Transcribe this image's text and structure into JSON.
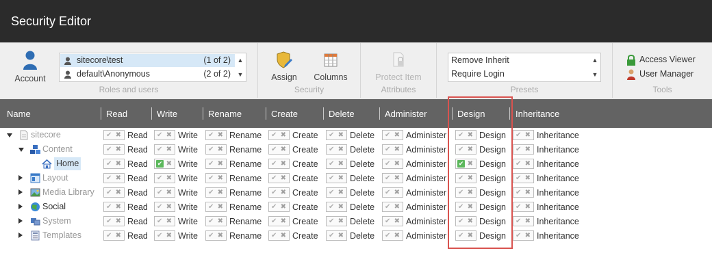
{
  "app": {
    "title": "Security Editor"
  },
  "ribbon": {
    "account_label": "Account",
    "users_list": [
      {
        "name": "sitecore\\test",
        "count": "(1 of 2)",
        "selected": true
      },
      {
        "name": "default\\Anonymous",
        "count": "(2 of 2)",
        "selected": false
      }
    ],
    "roles_group_label": "Roles and users",
    "assign_label": "Assign",
    "columns_label": "Columns",
    "security_group_label": "Security",
    "protect_item_label": "Protect Item",
    "attributes_group_label": "Attributes",
    "presets": [
      "Remove Inherit",
      "Require Login"
    ],
    "presets_group_label": "Presets",
    "access_viewer_label": "Access Viewer",
    "user_manager_label": "User Manager",
    "tools_group_label": "Tools"
  },
  "columns": [
    "Name",
    "Read",
    "Write",
    "Rename",
    "Create",
    "Delete",
    "Administer",
    "Design",
    "Inheritance"
  ],
  "permission_labels": [
    "Read",
    "Write",
    "Rename",
    "Create",
    "Delete",
    "Administer",
    "Design",
    "Inheritance"
  ],
  "tree": [
    {
      "name": "sitecore",
      "expander": "down",
      "icon": "page-icon",
      "style": "muted",
      "granted": []
    },
    {
      "name": "Content",
      "expander": "down",
      "icon": "cubes-icon",
      "style": "muted",
      "granted": []
    },
    {
      "name": "Home",
      "expander": "none",
      "icon": "home-icon",
      "style": "selected",
      "granted": [
        "Write",
        "Design"
      ]
    },
    {
      "name": "Layout",
      "expander": "right",
      "icon": "layout-icon",
      "style": "muted",
      "granted": []
    },
    {
      "name": "Media Library",
      "expander": "right",
      "icon": "image-icon",
      "style": "muted",
      "granted": []
    },
    {
      "name": "Social",
      "expander": "right",
      "icon": "globe-icon",
      "style": "dark",
      "granted": []
    },
    {
      "name": "System",
      "expander": "right",
      "icon": "system-icon",
      "style": "muted",
      "granted": []
    },
    {
      "name": "Templates",
      "expander": "right",
      "icon": "template-icon",
      "style": "muted",
      "granted": []
    }
  ],
  "colors": {
    "titlebar": "#2b2b2b",
    "header": "#636363",
    "selection": "#d6e8f7",
    "granted_check": "#5cb85c",
    "highlight_box": "#d9534f"
  }
}
